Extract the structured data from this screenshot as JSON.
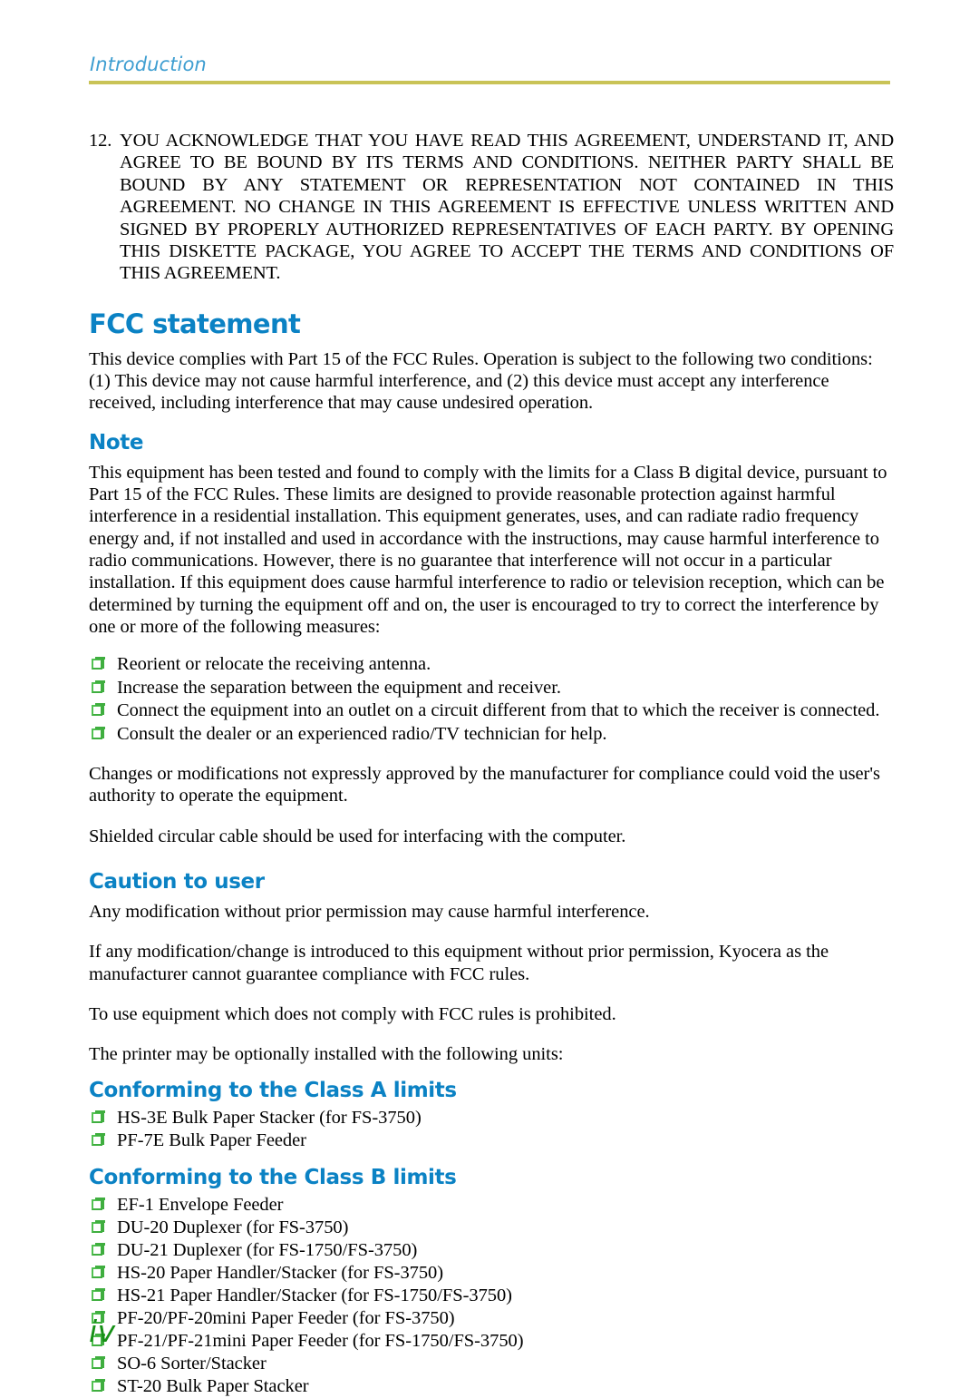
{
  "header": {
    "running_head": "Introduction",
    "rule_color": "#c9c357",
    "text_color": "#3e9ed1"
  },
  "colors": {
    "heading_blue": "#0b82c4",
    "bullet_green": "#3fae3f",
    "folio_green": "#169016",
    "body_black": "#000000"
  },
  "agreement": {
    "number": "12.",
    "text": "YOU ACKNOWLEDGE THAT YOU HAVE READ THIS AGREEMENT, UNDERSTAND IT, AND AGREE TO BE BOUND BY ITS TERMS AND CONDITIONS.  NEITHER PARTY SHALL BE BOUND BY ANY STATEMENT OR REPRESENTATION NOT CONTAINED IN THIS AGREEMENT.  NO CHANGE IN THIS AGREEMENT IS EFFECTIVE UNLESS WRITTEN AND SIGNED BY PROPERLY AUTHORIZED REPRESENTATIVES OF EACH PARTY.  BY OPENING THIS DISKETTE PACKAGE, YOU AGREE TO ACCEPT THE TERMS AND CONDITIONS OF THIS AGREEMENT."
  },
  "fcc": {
    "heading": "FCC statement",
    "paragraph": "This device complies with Part 15 of the FCC Rules. Operation is subject to the following two conditions: (1) This device may not cause harmful interference, and (2) this device must accept any interference received, including interference that may cause undesired operation."
  },
  "note": {
    "heading": "Note",
    "paragraph": "This equipment has been tested and found to comply with the limits for a Class B digital device, pursuant to Part 15 of the FCC Rules. These limits are designed to provide reasonable protection against harmful interference in a residential installation. This equipment generates, uses, and can radiate radio frequency energy and, if not installed and used in accordance with the instructions, may cause harmful interference to radio communications. However, there is no guarantee that interference will not occur in a particular installation. If this equipment does cause harmful interference to radio or television reception, which can be determined by turning the equipment off and on, the user is encouraged to try to correct the interference by one or more of the following measures:",
    "measures": [
      "Reorient or relocate the receiving antenna.",
      "Increase the separation between the equipment and receiver.",
      "Connect the equipment into an outlet on a circuit different from that to which the receiver is connected.",
      "Consult the dealer or an experienced radio/TV technician for help."
    ],
    "after_1": "Changes or modifications not expressly approved by the manufacturer for compliance could void the user's authority to operate the equipment.",
    "after_2": "Shielded circular cable should be used for interfacing with the computer."
  },
  "caution": {
    "heading": "Caution to user",
    "paragraph_1": "Any modification without prior permission may cause harmful interference.",
    "paragraph_2": "If any modification/change is introduced to this equipment without prior permission, Kyocera as the manufacturer cannot guarantee compliance with FCC rules.",
    "paragraph_3": "To use equipment which does not comply with FCC rules is prohibited.",
    "paragraph_4": "The printer may be optionally installed with the following units:"
  },
  "class_a": {
    "heading": "Conforming to the Class A limits",
    "units": [
      "HS-3E Bulk Paper Stacker (for FS-3750)",
      "PF-7E Bulk Paper Feeder"
    ]
  },
  "class_b": {
    "heading": "Conforming to the Class B limits",
    "units": [
      "EF-1 Envelope Feeder",
      "DU-20 Duplexer (for FS-3750)",
      "DU-21 Duplexer (for FS-1750/FS-3750)",
      "HS-20 Paper Handler/Stacker (for FS-3750)",
      "HS-21 Paper Handler/Stacker (for FS-1750/FS-3750)",
      "PF-20/PF-20mini Paper Feeder (for FS-3750)",
      "PF-21/PF-21mini Paper Feeder (for FS-1750/FS-3750)",
      "SO-6 Sorter/Stacker",
      "ST-20 Bulk Paper Stacker"
    ]
  },
  "footer": {
    "page_number": "iv"
  }
}
